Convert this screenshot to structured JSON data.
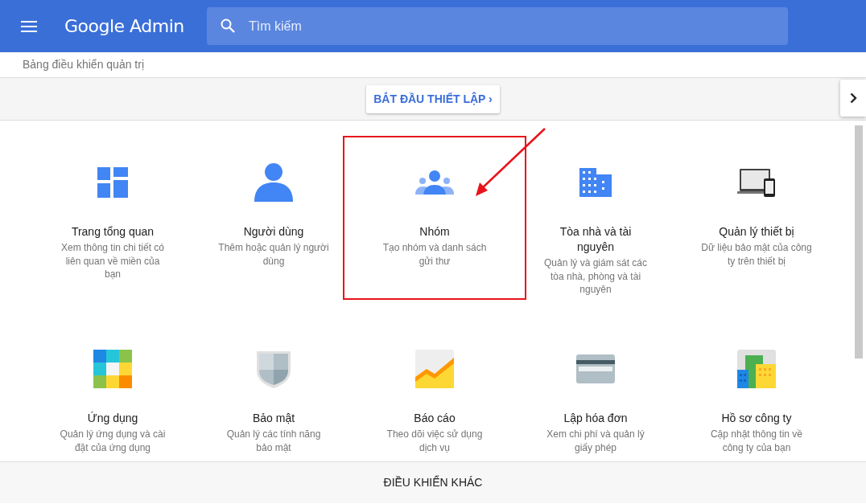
{
  "header": {
    "title": "Google Admin",
    "search": {
      "placeholder": "Tìm kiếm"
    }
  },
  "breadcrumb": "Bảng điều khiển quản trị",
  "setup_button": "BẮT ĐẦU THIẾT LẬP ›",
  "cards": [
    {
      "title": "Trang tổng quan",
      "description": "Xem thông tin chi tiết có liên quan về miền của bạn",
      "highlighted": false
    },
    {
      "title": "Người dùng",
      "description": "Thêm hoặc quản lý người dùng",
      "highlighted": false
    },
    {
      "title": "Nhóm",
      "description": "Tạo nhóm và danh sách gửi thư",
      "highlighted": true
    },
    {
      "title": "Tòa nhà và tài nguyên",
      "description": "Quản lý và giám sát các tòa nhà, phòng và tài nguyên",
      "highlighted": false
    },
    {
      "title": "Quản lý thiết bị",
      "description": "Dữ liệu bảo mật của công ty trên thiết bị",
      "highlighted": false
    },
    {
      "title": "Ứng dụng",
      "description": "Quản lý ứng dụng và cài đặt của ứng dụng",
      "highlighted": false
    },
    {
      "title": "Bảo mật",
      "description": "Quản lý các tính năng bảo mật",
      "highlighted": false
    },
    {
      "title": "Báo cáo",
      "description": "Theo dõi việc sử dụng dịch vụ",
      "highlighted": false
    },
    {
      "title": "Lập hóa đơn",
      "description": "Xem chi phí và quản lý giấy phép",
      "highlighted": false
    },
    {
      "title": "Hồ sơ công ty",
      "description": "Cập nhật thông tin về công ty của bạn",
      "highlighted": false
    }
  ],
  "more_controls": "ĐIỀU KHIỂN KHÁC"
}
